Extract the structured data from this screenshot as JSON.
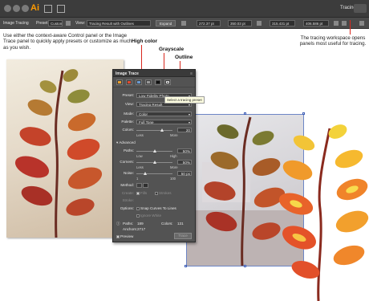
{
  "app": {
    "logo": "Ai",
    "workspace": "Tracing",
    "icons": [
      "close-dot",
      "minimize-dot",
      "zoom-dot",
      "bridge-icon",
      "arrange-documents-icon",
      "search-icon"
    ]
  },
  "control_bar": {
    "label": "Image Tracing",
    "preset_label": "Preset:",
    "preset_value": "Custom",
    "view_label": "View:",
    "view_value": "Tracing Result with Outlines",
    "expand_button": "Expand",
    "x_value": "272.37 pt",
    "y_value": "350.03 pt",
    "w_value": "315.431 pt",
    "h_value": "406.586 pt"
  },
  "callouts": {
    "intro": "Use either the context-aware Control panel or the Image Trace panel to quickly apply presets or customize as much as you wish.",
    "high_color": "High color",
    "grayscale": "Grayscale",
    "outline": "Outline",
    "right_note": "The tracing workspace opens panels most useful for tracing.",
    "accent_color": "#d8281e"
  },
  "panel": {
    "title": "Image Trace",
    "tooltip": "Select a tracing preset",
    "preset_icons": [
      "auto-color-icon",
      "high-color-icon",
      "low-color-icon",
      "grayscale-icon",
      "black-and-white-icon",
      "outline-icon"
    ],
    "preset_label": "Preset:",
    "preset_value": "Low Fidelity Photo",
    "view_label": "View:",
    "view_value": "Tracing Result",
    "mode_label": "Mode:",
    "mode_value": "Color",
    "palette_label": "Palette:",
    "palette_value": "Full Tone",
    "colors_label": "Colors:",
    "colors_value": "20",
    "colors_fraction": 0.72,
    "colors_min": "Less",
    "colors_max": "More",
    "advanced_label": "Advanced",
    "paths_label": "Paths:",
    "paths_value": "50%",
    "paths_fraction": 0.5,
    "paths_min": "Low",
    "paths_max": "High",
    "corners_label": "Corners:",
    "corners_value": "50%",
    "corners_fraction": 0.5,
    "corners_min": "Less",
    "corners_max": "More",
    "noise_label": "Noise:",
    "noise_value": "50 px",
    "noise_fraction": 0.25,
    "noise_min": "1",
    "noise_max": "100",
    "method_label": "Method:",
    "create_label": "Create:",
    "fills_label": "Fills",
    "strokes_label": "Strokes",
    "stroke_label": "Stroke:",
    "options_label": "Options:",
    "snap_label": "Snap Curves To Lines",
    "ignore_white_label": "Ignore White",
    "paths_stat_label": "Paths:",
    "paths_stat_value": "189",
    "colors_stat_label": "Colors:",
    "colors_stat_value": "131",
    "anchors_stat_label": "Anchors:",
    "anchors_stat_value": "2717",
    "preview_label": "Preview",
    "trace_button": "Trace"
  }
}
